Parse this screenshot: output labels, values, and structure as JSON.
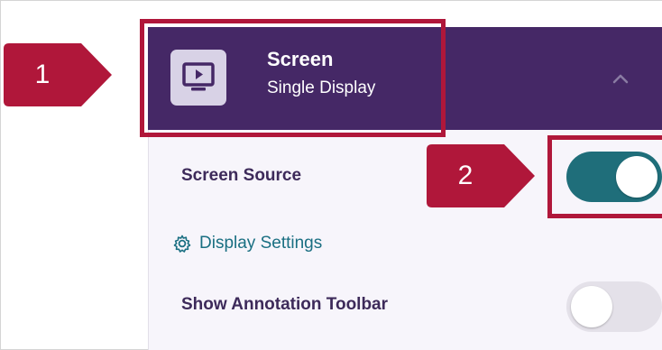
{
  "section": {
    "title": "Screen",
    "subtitle": "Single Display",
    "icon": "screen-play-icon",
    "expanded": true
  },
  "settings": {
    "screen_source": {
      "label": "Screen Source",
      "enabled": true
    },
    "display_settings": {
      "label": "Display Settings",
      "icon": "gear-icon"
    },
    "annotation_toolbar": {
      "label": "Show Annotation Toolbar",
      "enabled": false
    }
  },
  "callouts": [
    {
      "number": "1"
    },
    {
      "number": "2"
    }
  ],
  "colors": {
    "header_bg": "#452866",
    "panel_bg": "#f7f5fb",
    "highlight": "#b0173a",
    "toggle_on": "#1f6e7a",
    "toggle_off": "#e4e1e9",
    "link": "#1a6f82",
    "label": "#3d2a5a"
  }
}
